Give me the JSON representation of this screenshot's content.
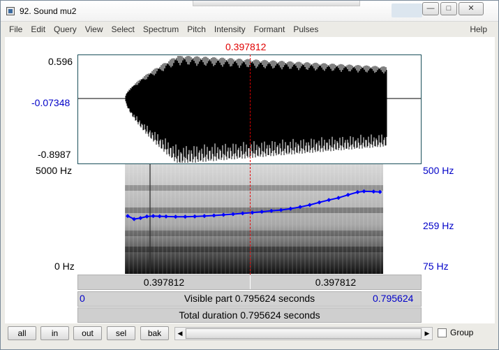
{
  "window": {
    "title": "92. Sound mu2",
    "controls": {
      "minimize": "—",
      "maximize": "□",
      "close": "✕"
    }
  },
  "menu": {
    "items": [
      "File",
      "Edit",
      "Query",
      "View",
      "Select",
      "Spectrum",
      "Pitch",
      "Intensity",
      "Formant",
      "Pulses"
    ],
    "help": "Help"
  },
  "cursor": {
    "time_label": "0.397812",
    "time": 0.397812
  },
  "waveform": {
    "y_max": "0.596",
    "y_cursor": "-0.07348",
    "y_min": "-0.8987"
  },
  "spectrogram": {
    "freq_max": "5000 Hz",
    "freq_min": "0 Hz",
    "pitch_max": "500 Hz",
    "pitch_mid": "259 Hz",
    "pitch_min": "75 Hz"
  },
  "pitch_track": {
    "color": "#0000ff",
    "times": [
      0.0,
      0.02,
      0.04,
      0.06,
      0.08,
      0.1,
      0.12,
      0.15,
      0.18,
      0.21,
      0.24,
      0.27,
      0.3,
      0.33,
      0.36,
      0.39,
      0.42,
      0.45,
      0.48,
      0.51,
      0.54,
      0.57,
      0.6,
      0.63,
      0.66,
      0.69,
      0.72,
      0.74,
      0.77,
      0.79
    ],
    "hz": [
      212,
      200,
      204,
      210,
      212,
      211,
      210,
      209,
      209,
      210,
      212,
      214,
      217,
      220,
      223,
      226,
      230,
      234,
      238,
      244,
      252,
      262,
      275,
      288,
      300,
      318,
      335,
      340,
      338,
      336
    ]
  },
  "time_bars": {
    "left_time": "0.397812",
    "right_time": "0.397812",
    "visible_start": "0",
    "visible_text": "Visible part 0.795624 seconds",
    "visible_end": "0.795624",
    "total_text": "Total duration 0.795624 seconds"
  },
  "toolbar": {
    "buttons": [
      "all",
      "in",
      "out",
      "sel",
      "bak"
    ],
    "group_label": "Group",
    "group_checked": false
  },
  "colors": {
    "cursor": "#e00000",
    "axis_blue": "#0000c8"
  }
}
